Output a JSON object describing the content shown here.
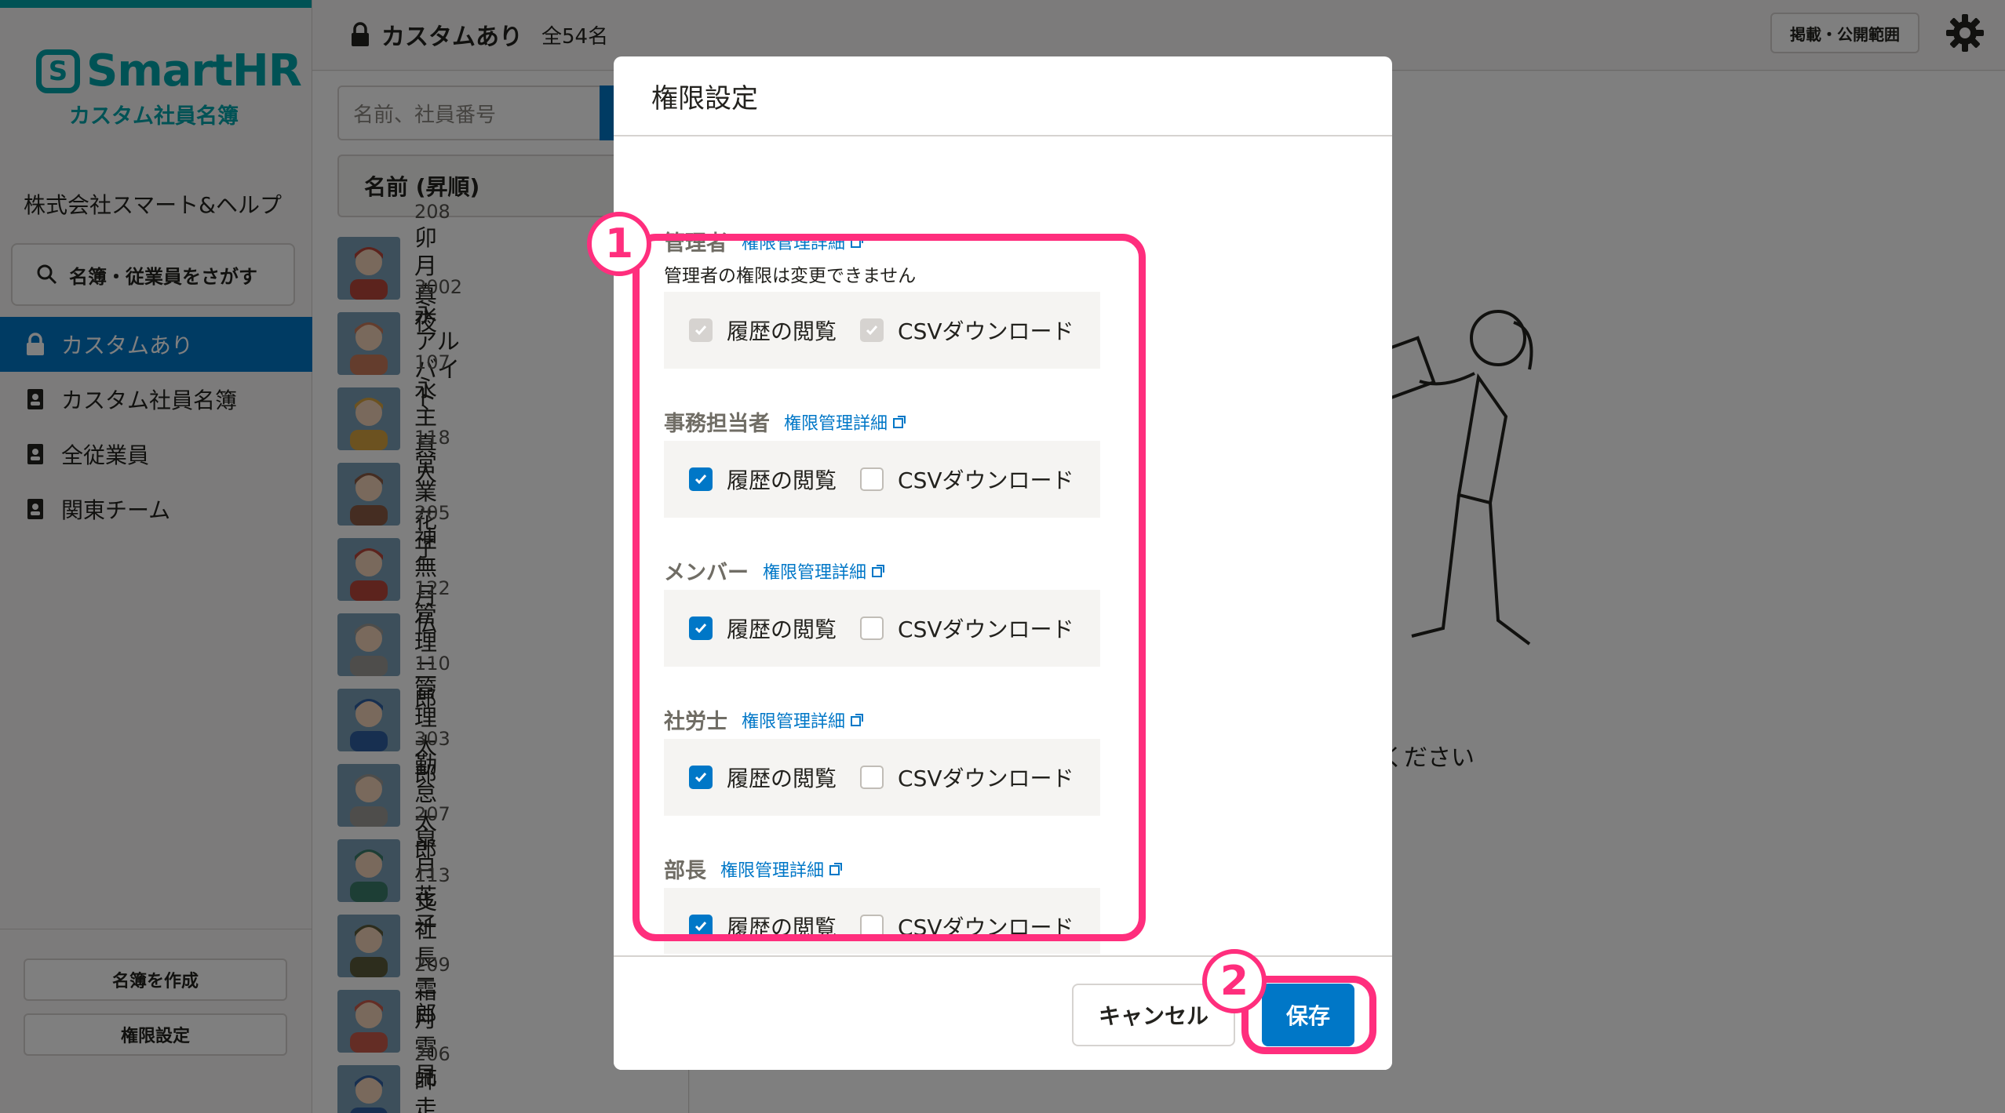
{
  "brand": {
    "logo_letter": "S",
    "name": "SmartHR",
    "sub": "カスタム社員名簿",
    "color": "#00a5ab"
  },
  "company": "株式会社スマート&ヘルプ",
  "sidebar": {
    "search_label": "名簿・従業員をさがす",
    "items": [
      {
        "label": "カスタムあり",
        "icon": "lock-icon",
        "active": true
      },
      {
        "label": "カスタム社員名簿",
        "icon": "roster-icon",
        "active": false
      },
      {
        "label": "全従業員",
        "icon": "roster-icon",
        "active": false
      },
      {
        "label": "関東チーム",
        "icon": "roster-icon",
        "active": false
      }
    ],
    "create_label": "名簿を作成",
    "permission_label": "権限設定"
  },
  "header": {
    "title": "カスタムあり",
    "count": "全54名",
    "publish_label": "掲載・公開範囲"
  },
  "list": {
    "search_placeholder": "名前、社員番号",
    "sort_label": "名前 (昇順)",
    "employees": [
      {
        "num": "208",
        "name": "卯月 真夜"
      },
      {
        "num": "3002",
        "name": "永 アルバイト"
      },
      {
        "num": "107",
        "name": "永 主真人"
      },
      {
        "num": "118",
        "name": "営業 花子"
      },
      {
        "num": "205",
        "name": "神無月 仏"
      },
      {
        "num": "122",
        "name": "管理 二郎"
      },
      {
        "num": "110",
        "name": "管理 太郎"
      },
      {
        "num": "303",
        "name": "勤怠 太郎"
      },
      {
        "num": "207",
        "name": "皐月 花子"
      },
      {
        "num": "113",
        "name": "支社長 二郎"
      },
      {
        "num": "209",
        "name": "霜月 雪見"
      },
      {
        "num": "206",
        "name": "師走 歩"
      }
    ]
  },
  "empty": {
    "text": "ください"
  },
  "modal": {
    "title": "権限設定",
    "detail_link": "権限管理詳細",
    "view_label": "履歴の閲覧",
    "csv_label": "CSVダウンロード",
    "admin_note": "管理者の権限は変更できません",
    "roles": [
      {
        "name": "管理者",
        "view": true,
        "csv": true,
        "disabled": true
      },
      {
        "name": "事務担当者",
        "view": true,
        "csv": false,
        "disabled": false
      },
      {
        "name": "メンバー",
        "view": true,
        "csv": false,
        "disabled": false
      },
      {
        "name": "社労士",
        "view": true,
        "csv": false,
        "disabled": false
      },
      {
        "name": "部長",
        "view": true,
        "csv": false,
        "disabled": false
      }
    ],
    "cancel_label": "キャンセル",
    "save_label": "保存"
  },
  "annotations": {
    "step1": "1",
    "step2": "2",
    "color": "#ff2e7d"
  }
}
